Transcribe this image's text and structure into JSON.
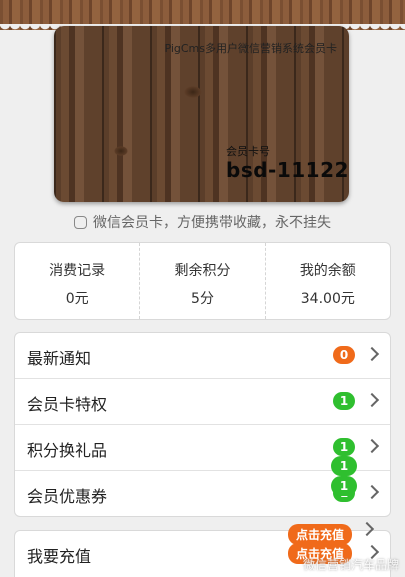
{
  "card": {
    "title": "PigCms多用户微信营销系统会员卡",
    "number_label": "会员卡号",
    "number": "bsd-11122"
  },
  "slogan": "微信会员卡，方便携带收藏，永不挂失",
  "stats": [
    {
      "label": "消费记录",
      "value": "0元"
    },
    {
      "label": "剩余积分",
      "value": "5分"
    },
    {
      "label": "我的余额",
      "value": "34.00元"
    }
  ],
  "menu1": [
    {
      "label": "最新通知",
      "badge": "0",
      "badge_color": "#f06a1a"
    },
    {
      "label": "会员卡特权",
      "badge": "1",
      "badge_color": "#2fbf2f"
    },
    {
      "label": "积分换礼品",
      "badge": "1",
      "badge_color": "#2fbf2f"
    },
    {
      "label": "会员优惠券",
      "badge": "1",
      "badge_color": "#2fbf2f"
    }
  ],
  "menu2": [
    {
      "label": "我要充值"
    }
  ],
  "floating": {
    "recharge_a": "点击充值",
    "recharge_b": "点击充值",
    "badge_a": "1",
    "badge_b": "1"
  },
  "watermark": "微信营销汽车品牌",
  "colors": {
    "orange": "#f06a1a",
    "green": "#2fbf2f"
  }
}
